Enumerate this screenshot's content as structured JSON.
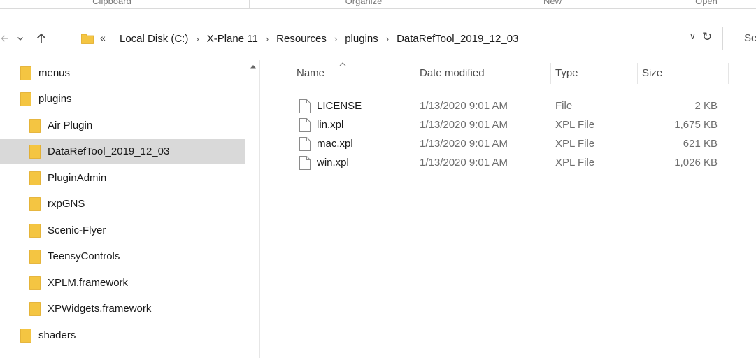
{
  "ribbon": {
    "groups": [
      "Clipboard",
      "Organize",
      "New",
      "Open"
    ]
  },
  "nav": {
    "back_icon": "arrow-left-icon",
    "recent_icon": "chevron-down-icon",
    "up_icon": "arrow-up-icon"
  },
  "address": {
    "overflow": "«",
    "crumbs": [
      "Local Disk (C:)",
      "X-Plane 11",
      "Resources",
      "plugins",
      "DataRefTool_2019_12_03"
    ],
    "separator": "›",
    "dropdown": "∨",
    "refresh": "↻"
  },
  "search": {
    "placeholder": "Se"
  },
  "tree": {
    "items": [
      {
        "label": "menus",
        "level": 0
      },
      {
        "label": "plugins",
        "level": 0
      },
      {
        "label": "Air Plugin",
        "level": 1
      },
      {
        "label": "DataRefTool_2019_12_03",
        "level": 1,
        "selected": true
      },
      {
        "label": "PluginAdmin",
        "level": 1
      },
      {
        "label": "rxpGNS",
        "level": 1
      },
      {
        "label": "Scenic-Flyer",
        "level": 1
      },
      {
        "label": "TeensyControls",
        "level": 1
      },
      {
        "label": "XPLM.framework",
        "level": 1
      },
      {
        "label": "XPWidgets.framework",
        "level": 1
      },
      {
        "label": "shaders",
        "level": 0
      }
    ]
  },
  "file_list": {
    "columns": {
      "name": "Name",
      "date": "Date modified",
      "type": "Type",
      "size": "Size"
    },
    "rows": [
      {
        "name": "LICENSE",
        "date": "1/13/2020 9:01 AM",
        "type": "File",
        "size": "2 KB"
      },
      {
        "name": "lin.xpl",
        "date": "1/13/2020 9:01 AM",
        "type": "XPL File",
        "size": "1,675 KB"
      },
      {
        "name": "mac.xpl",
        "date": "1/13/2020 9:01 AM",
        "type": "XPL File",
        "size": "621 KB"
      },
      {
        "name": "win.xpl",
        "date": "1/13/2020 9:01 AM",
        "type": "XPL File",
        "size": "1,026 KB"
      }
    ]
  },
  "colors": {
    "folder": "#f4c542",
    "folder_dark": "#e0a820",
    "selected": "#d9d9d9",
    "up_arrow": "#4a4a4a"
  }
}
